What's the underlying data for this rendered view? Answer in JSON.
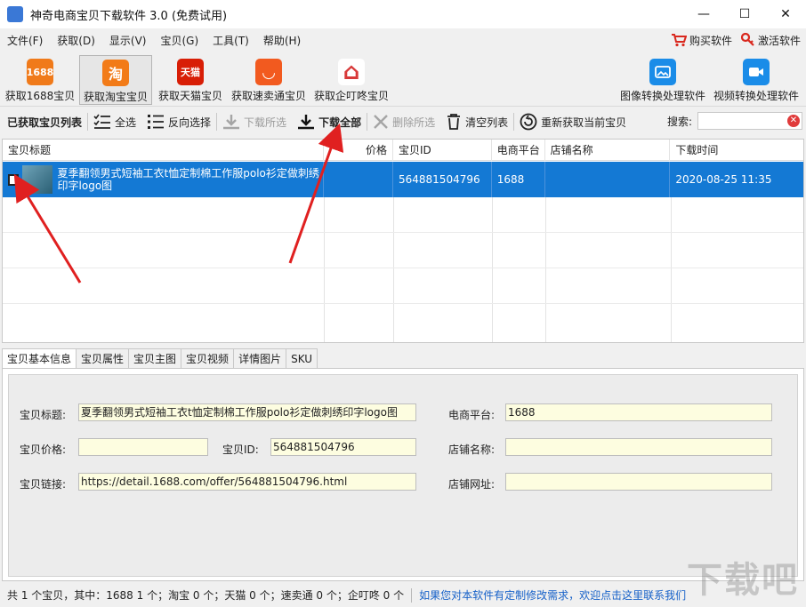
{
  "window": {
    "title": "神奇电商宝贝下载软件 3.0 (免费试用)",
    "controls": {
      "minimize": "—",
      "maximize": "☐",
      "close": "✕"
    }
  },
  "menu": {
    "items": [
      "文件(F)",
      "获取(D)",
      "显示(V)",
      "宝贝(G)",
      "工具(T)",
      "帮助(H)"
    ],
    "buy": "购买软件",
    "activate": "激活软件"
  },
  "big_toolbar": {
    "buttons": [
      {
        "label": "获取1688宝贝",
        "icon_text": "1688",
        "icon": "1688-icon",
        "color": "#f07a1a"
      },
      {
        "label": "获取淘宝宝贝",
        "icon_text": "淘",
        "icon": "taobao-icon",
        "color": "#f27b18"
      },
      {
        "label": "获取天猫宝贝",
        "icon_text": "天猫",
        "icon": "tmall-icon",
        "color": "#d81e06"
      },
      {
        "label": "获取速卖通宝贝",
        "icon_text": "◡",
        "icon": "aliexpress-icon",
        "color": "#f25a1f"
      },
      {
        "label": "获取企叮咚宝贝",
        "icon_text": "⌂",
        "icon": "qidingdong-icon",
        "color": "#d83a3a"
      }
    ],
    "image_tool": "图像转换处理软件",
    "video_tool": "视频转换处理软件",
    "tool_color": "#1a8ce8"
  },
  "toolbar": {
    "list_label": "已获取宝贝列表",
    "select_all": "全选",
    "invert": "反向选择",
    "download_selected": "下载所选",
    "download_all": "下载全部",
    "delete_selected": "删除所选",
    "clear_list": "清空列表",
    "refetch": "重新获取当前宝贝",
    "search_label": "搜索:",
    "search_value": ""
  },
  "table": {
    "headers": [
      "宝贝标题",
      "价格",
      "宝贝ID",
      "电商平台",
      "店铺名称",
      "下载时间"
    ],
    "rows": [
      {
        "title": "夏季翻领男式短袖工衣t恤定制棉工作服polo衫定做刺绣印字logo图",
        "price": "",
        "id": "564881504796",
        "platform": "1688",
        "shop": "",
        "time": "2020-08-25 11:35"
      }
    ]
  },
  "tabs": [
    "宝贝基本信息",
    "宝贝属性",
    "宝贝主图",
    "宝贝视频",
    "详情图片",
    "SKU"
  ],
  "details": {
    "title_label": "宝贝标题:",
    "title_value": "夏季翻领男式短袖工衣t恤定制棉工作服polo衫定做刺绣印字logo图",
    "platform_label": "电商平台:",
    "platform_value": "1688",
    "price_label": "宝贝价格:",
    "price_value": "",
    "id_label": "宝贝ID:",
    "id_value": "564881504796",
    "shop_label": "店铺名称:",
    "shop_value": "",
    "link_label": "宝贝链接:",
    "link_value": "https://detail.1688.com/offer/564881504796.html",
    "shop_url_label": "店铺网址:",
    "shop_url_value": ""
  },
  "status": {
    "summary": "共 1 个宝贝，其中：1688 1 个；淘宝 0 个；天猫 0 个；速卖通 0 个；企叮咚 0 个",
    "link": "如果您对本软件有定制修改需求，欢迎点击这里联系我们"
  },
  "watermark": "下载吧"
}
